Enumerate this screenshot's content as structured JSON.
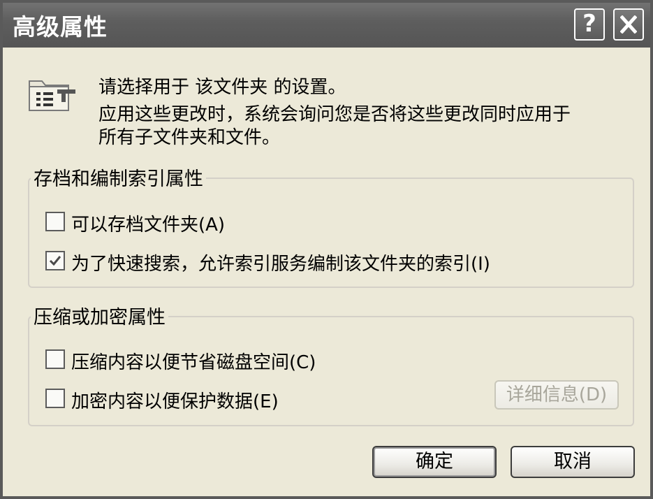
{
  "window": {
    "title": "高级属性",
    "help_label": "?",
    "close_icon": "close-icon"
  },
  "intro": {
    "icon": "folder-properties-icon",
    "line1": "请选择用于 该文件夹 的设置。",
    "line2": "应用这些更改时，系统会询问您是否将这些更改同时应用于",
    "line3": "所有子文件夹和文件。"
  },
  "archive_group": {
    "title": "存档和编制索引属性",
    "archive_checkbox": {
      "label": "可以存档文件夹(A)",
      "checked": false
    },
    "index_checkbox": {
      "label": "为了快速搜索，允许索引服务编制该文件夹的索引(I)",
      "checked": true
    }
  },
  "compress_group": {
    "title": "压缩或加密属性",
    "compress_checkbox": {
      "label": "压缩内容以便节省磁盘空间(C)",
      "checked": false
    },
    "encrypt_checkbox": {
      "label": "加密内容以便保护数据(E)",
      "checked": false
    },
    "details_button": {
      "label": "详细信息(D)",
      "enabled": false
    }
  },
  "footer": {
    "ok_label": "确定",
    "cancel_label": "取消"
  },
  "colors": {
    "titlebar": "#5e5e5e",
    "dialog_bg": "#ece9d8",
    "group_border": "#d4d0c8",
    "disabled_text": "#a8a69b"
  }
}
